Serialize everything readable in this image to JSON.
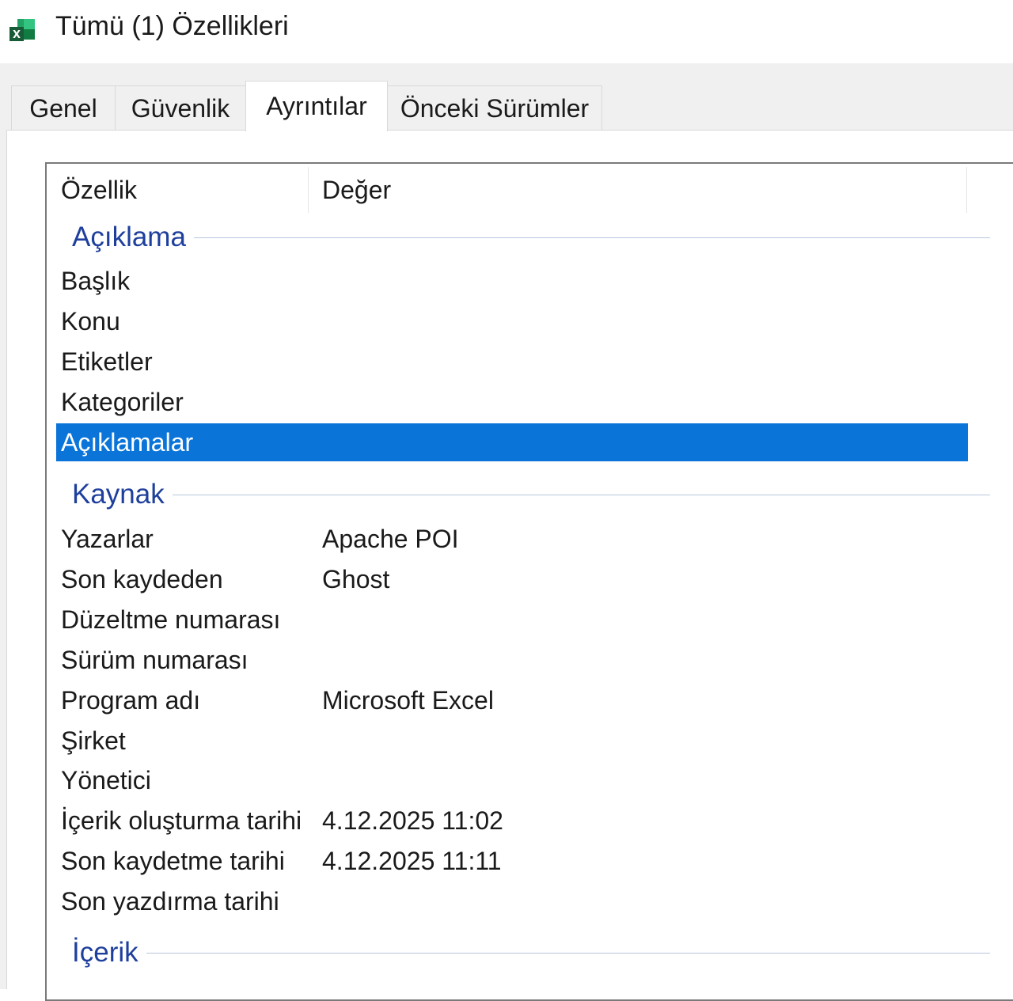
{
  "window": {
    "title": "Tümü (1) Özellikleri",
    "icon": "excel-file-icon"
  },
  "tabs": [
    {
      "label": "Genel",
      "active": false
    },
    {
      "label": "Güvenlik",
      "active": false
    },
    {
      "label": "Ayrıntılar",
      "active": true
    },
    {
      "label": "Önceki Sürümler",
      "active": false
    }
  ],
  "list": {
    "columns": {
      "property": "Özellik",
      "value": "Değer"
    },
    "groups": {
      "description": "Açıklama",
      "origin": "Kaynak",
      "content": "İçerik"
    },
    "rows": [
      {
        "property": "Başlık",
        "value": ""
      },
      {
        "property": "Konu",
        "value": ""
      },
      {
        "property": "Etiketler",
        "value": ""
      },
      {
        "property": "Kategoriler",
        "value": ""
      },
      {
        "property": "Açıklamalar",
        "value": "",
        "selected": true
      },
      {
        "property": "Yazarlar",
        "value": "Apache POI"
      },
      {
        "property": "Son kaydeden",
        "value": "Ghost"
      },
      {
        "property": "Düzeltme numarası",
        "value": ""
      },
      {
        "property": "Sürüm numarası",
        "value": ""
      },
      {
        "property": "Program adı",
        "value": "Microsoft Excel"
      },
      {
        "property": "Şirket",
        "value": ""
      },
      {
        "property": "Yönetici",
        "value": ""
      },
      {
        "property": "İçerik oluşturma tarihi",
        "value": "4.12.2025 11:02"
      },
      {
        "property": "Son kaydetme tarihi",
        "value": "4.12.2025 11:11"
      },
      {
        "property": "Son yazdırma tarihi",
        "value": ""
      }
    ]
  },
  "colors": {
    "selection": "#0a74d9",
    "group_heading": "#1e3f9c"
  }
}
